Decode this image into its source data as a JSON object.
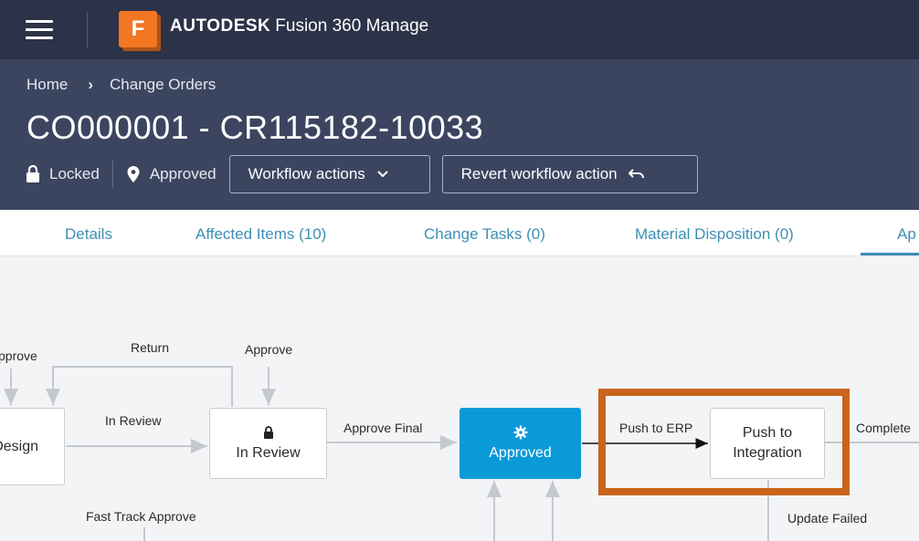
{
  "app": {
    "logo_letter": "F",
    "brand_bold": "AUTODESK",
    "brand_rest": "Fusion 360 Manage"
  },
  "breadcrumb": {
    "home": "Home",
    "section": "Change Orders"
  },
  "record": {
    "title": "CO000001 - CR115182-10033",
    "lock_status": "Locked",
    "workflow_state": "Approved"
  },
  "actions": {
    "workflow_actions": "Workflow actions",
    "revert": "Revert workflow action"
  },
  "tabs": [
    "Details",
    "Affected Items (10)",
    "Change Tasks (0)",
    "Material Disposition (0)",
    "Ap"
  ],
  "workflow": {
    "nodes": {
      "design": "Design",
      "in_review": "In Review",
      "approved": "Approved",
      "push_to_integration_1": "Push to",
      "push_to_integration_2": "Integration"
    },
    "transitions": {
      "approve_left": "pprove",
      "return": "Return",
      "approve": "Approve",
      "in_review": "In Review",
      "approve_final": "Approve Final",
      "push_to_erp": "Push to ERP",
      "complete": "Complete",
      "fast_track_approve": "Fast Track Approve",
      "update_failed": "Update Failed"
    }
  },
  "colors": {
    "topbar": "#2c3247",
    "header": "#3c4560",
    "accent": "#0a9ad8",
    "highlight": "#c8641c",
    "tab_text": "#3d8fb5"
  }
}
